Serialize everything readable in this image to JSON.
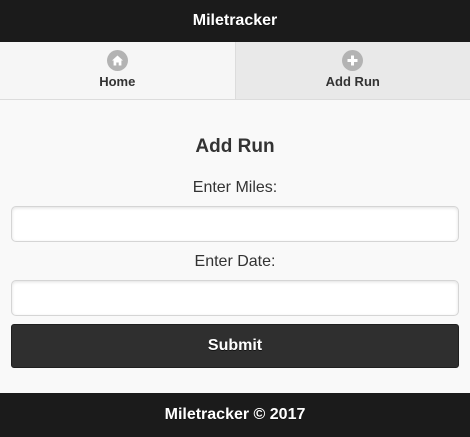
{
  "header": {
    "title": "Miletracker"
  },
  "navbar": {
    "items": [
      {
        "label": "Home",
        "icon": "home-icon",
        "active": false
      },
      {
        "label": "Add Run",
        "icon": "plus-icon",
        "active": true
      }
    ]
  },
  "form": {
    "title": "Add Run",
    "miles_label": "Enter Miles:",
    "miles_value": "",
    "date_label": "Enter Date:",
    "date_value": "",
    "submit_label": "Submit"
  },
  "footer": {
    "text": "Miletracker © 2017"
  },
  "colors": {
    "bar": "#1b1b1b",
    "button": "#2f2f2f",
    "icon": "#b3b3b3",
    "background": "#f9f9f9"
  }
}
